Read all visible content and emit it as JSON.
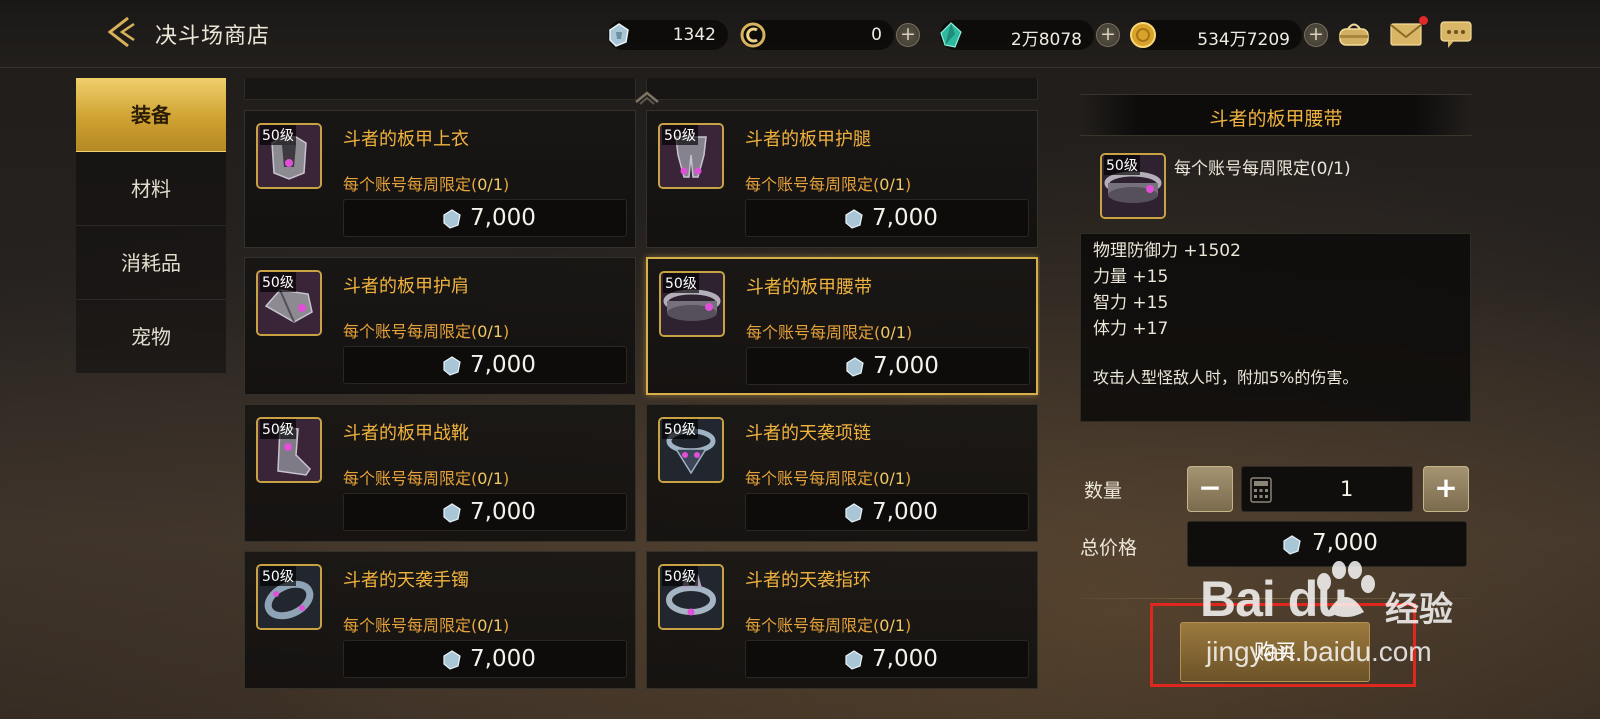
{
  "header": {
    "title": "决斗场商店",
    "currencies": [
      {
        "icon": "arena-crystal-icon",
        "value": "1342",
        "has_add": false
      },
      {
        "icon": "coin-c-icon",
        "value": "0",
        "has_add": true
      },
      {
        "icon": "green-gem-icon",
        "value": "2万8078",
        "has_add": true
      },
      {
        "icon": "gold-coin-icon",
        "value": "534万7209",
        "has_add": true
      }
    ],
    "actions": [
      "bag-icon",
      "mail-icon",
      "chat-icon"
    ]
  },
  "nav": {
    "items": [
      {
        "label": "装备",
        "active": true
      },
      {
        "label": "材料",
        "active": false
      },
      {
        "label": "消耗品",
        "active": false
      },
      {
        "label": "宠物",
        "active": false
      }
    ]
  },
  "products": [
    {
      "level": "50级",
      "name": "斗者的板甲上衣",
      "limit_prefix": "每个账号每周限定(",
      "limit_nums": "0/1",
      "limit_suffix": ")",
      "price": "7,000",
      "icon": "plate-chest-icon",
      "selected": false
    },
    {
      "level": "50级",
      "name": "斗者的板甲护腿",
      "limit_prefix": "每个账号每周限定(",
      "limit_nums": "0/1",
      "limit_suffix": ")",
      "price": "7,000",
      "icon": "plate-legs-icon",
      "selected": false
    },
    {
      "level": "50级",
      "name": "斗者的板甲护肩",
      "limit_prefix": "每个账号每周限定(",
      "limit_nums": "0/1",
      "limit_suffix": ")",
      "price": "7,000",
      "icon": "plate-shoulder-icon",
      "selected": false
    },
    {
      "level": "50级",
      "name": "斗者的板甲腰带",
      "limit_prefix": "每个账号每周限定(",
      "limit_nums": "0/1",
      "limit_suffix": ")",
      "price": "7,000",
      "icon": "plate-belt-icon",
      "selected": true
    },
    {
      "level": "50级",
      "name": "斗者的板甲战靴",
      "limit_prefix": "每个账号每周限定(",
      "limit_nums": "0/1",
      "limit_suffix": ")",
      "price": "7,000",
      "icon": "plate-boots-icon",
      "selected": false
    },
    {
      "level": "50级",
      "name": "斗者的天袭项链",
      "limit_prefix": "每个账号每周限定(",
      "limit_nums": "0/1",
      "limit_suffix": ")",
      "price": "7,000",
      "icon": "necklace-icon",
      "selected": false
    },
    {
      "level": "50级",
      "name": "斗者的天袭手镯",
      "limit_prefix": "每个账号每周限定(",
      "limit_nums": "0/1",
      "limit_suffix": ")",
      "price": "7,000",
      "icon": "bracelet-icon",
      "selected": false
    },
    {
      "level": "50级",
      "name": "斗者的天袭指环",
      "limit_prefix": "每个账号每周限定(",
      "limit_nums": "0/1",
      "limit_suffix": ")",
      "price": "7,000",
      "icon": "ring-icon",
      "selected": false
    }
  ],
  "detail": {
    "title": "斗者的板甲腰带",
    "level": "50级",
    "limit": "每个账号每周限定(0/1)",
    "stats": [
      "物理防御力 +1502",
      "力量 +15",
      "智力 +15",
      "体力 +17"
    ],
    "note": "攻击人型怪敌人时，附加5%的伤害。",
    "quantity_label": "数量",
    "quantity": "1",
    "minus": "−",
    "plus": "+",
    "total_label": "总价格",
    "total": "7,000",
    "buy_label": "购买"
  },
  "watermark": {
    "brand": "Bai du",
    "cn": "经验",
    "url": "jingyan.baidu.com"
  },
  "colors": {
    "accent_gold": "#f0b23e",
    "highlight_red": "#e0271f",
    "active_tab": "#cfa232"
  }
}
